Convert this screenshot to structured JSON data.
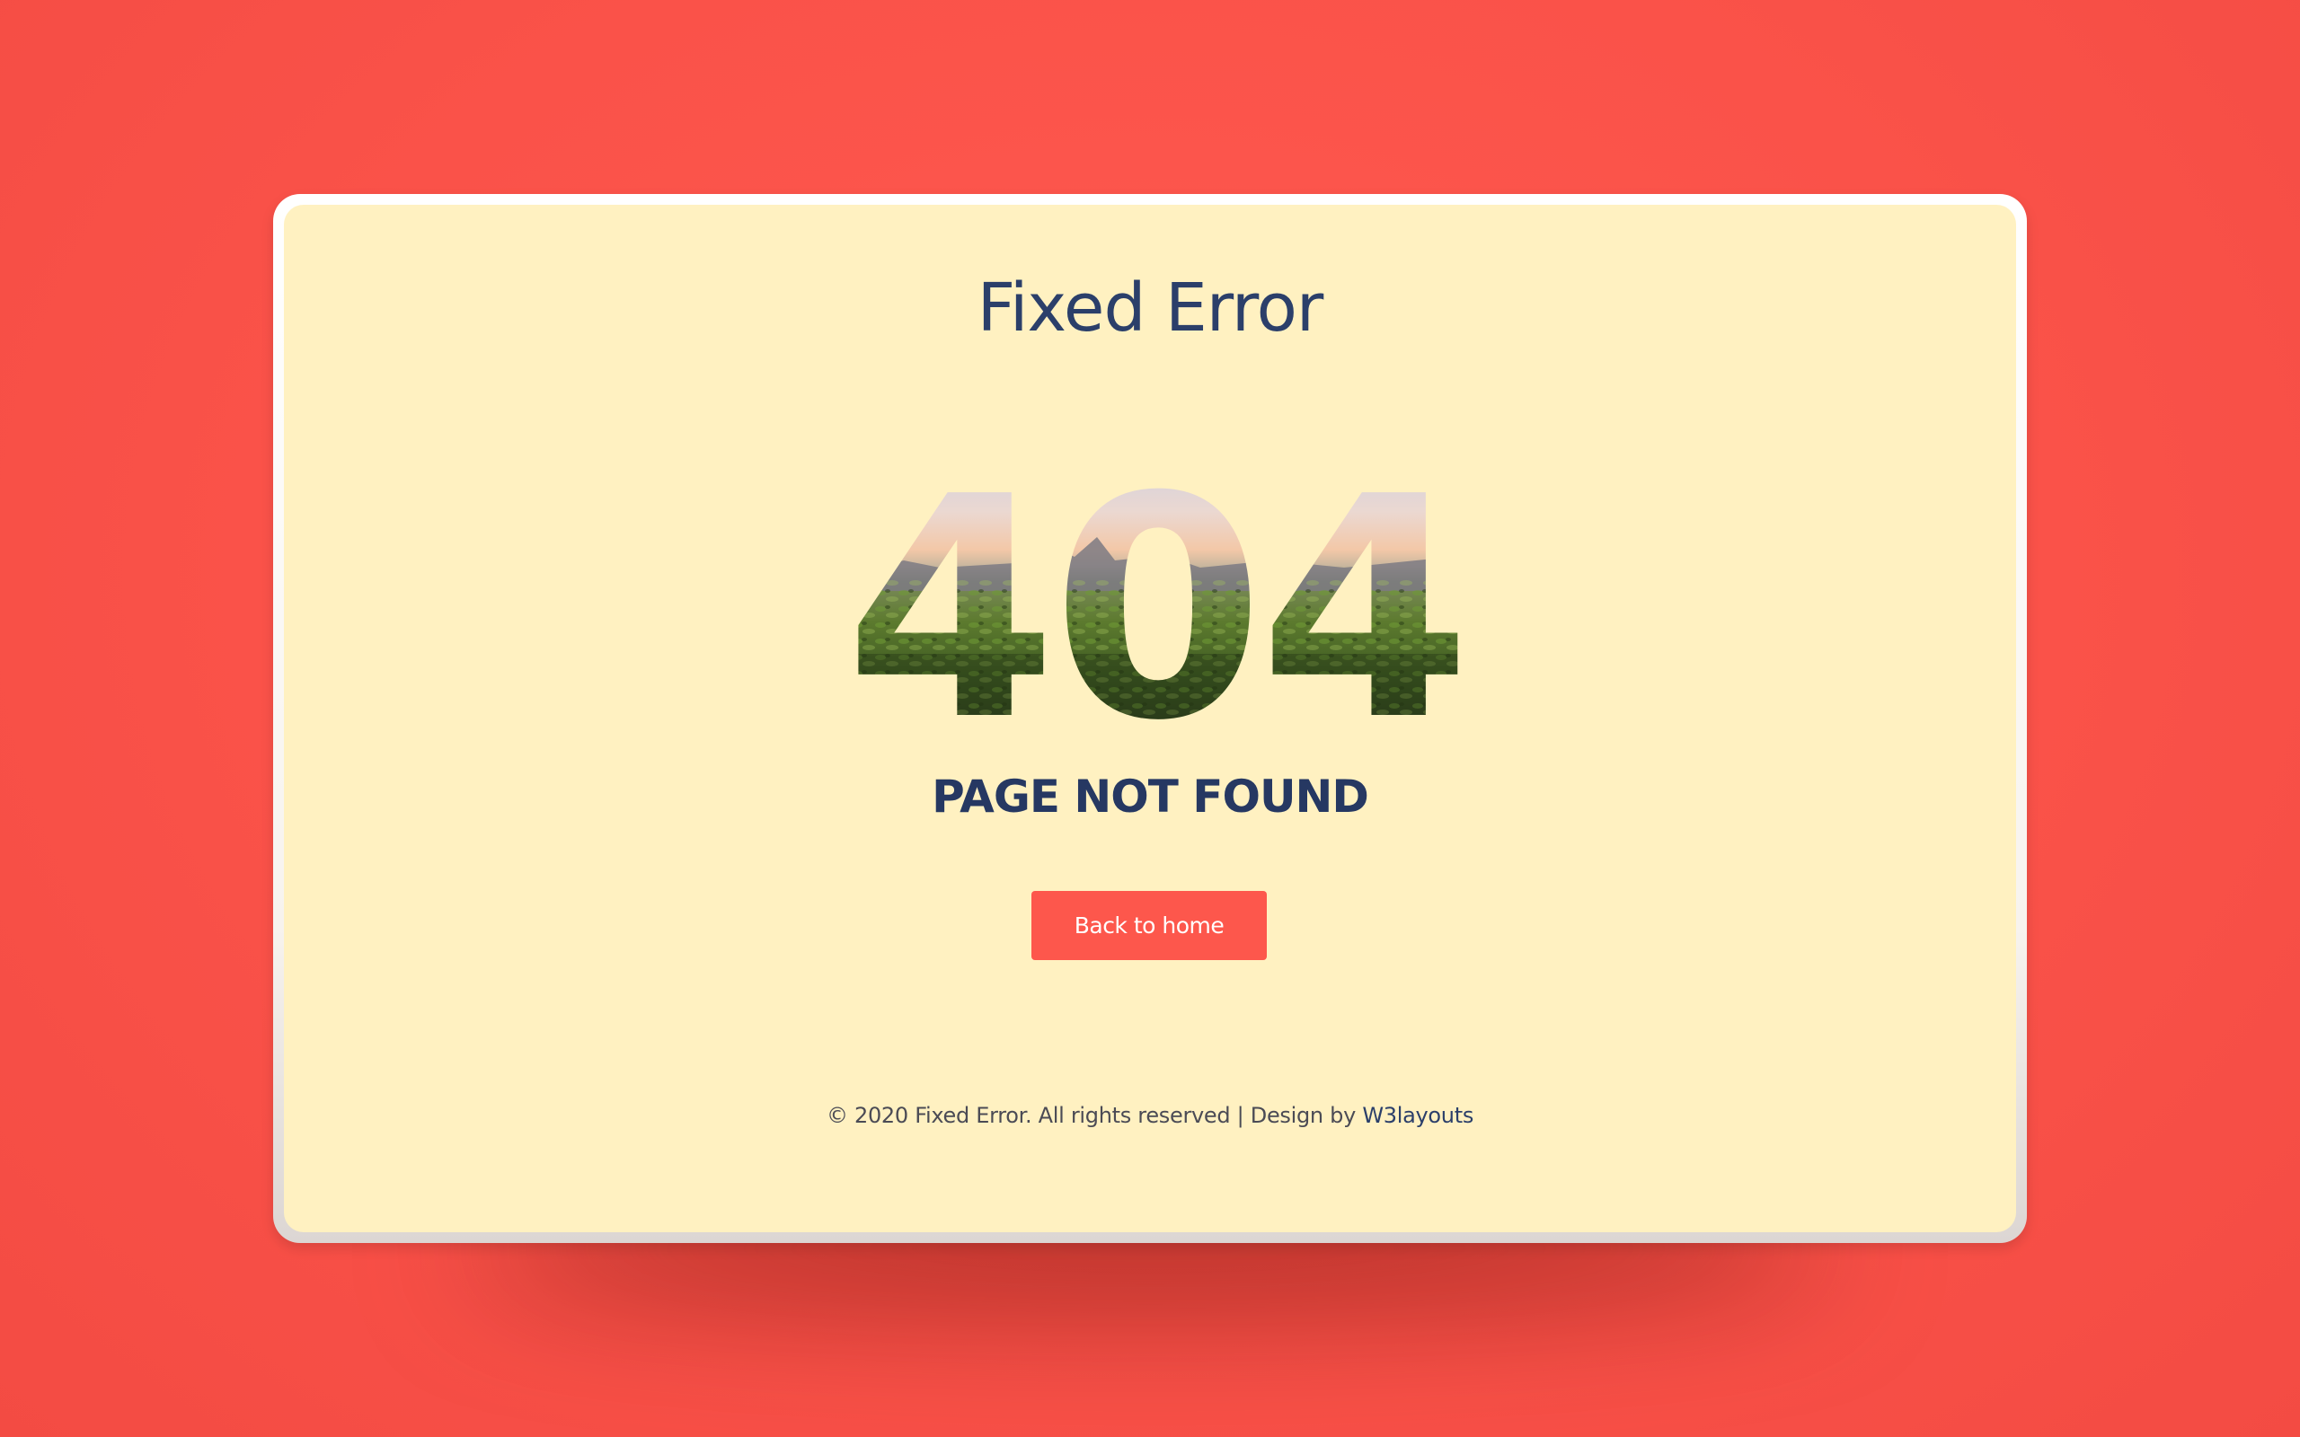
{
  "site": {
    "title": "Fixed Error"
  },
  "error": {
    "code": "404",
    "message": "PAGE NOT FOUND"
  },
  "actions": {
    "back_home_label": "Back to home"
  },
  "footer": {
    "copyright_text": "© 2020 Fixed Error. All rights reserved | Design by ",
    "designer_link": "W3layouts"
  },
  "colors": {
    "background": "#fa5249",
    "card": "#fff1c1",
    "heading": "#2b3f6a",
    "button": "#fd574c",
    "button_text": "#ffffff"
  }
}
